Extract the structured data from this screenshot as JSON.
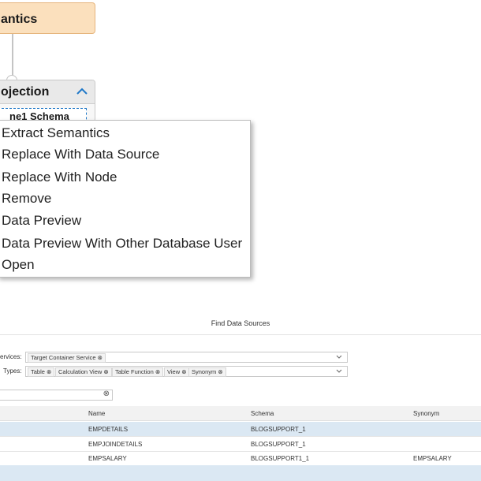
{
  "diagram": {
    "semantics_node_label": "antics",
    "projection_node_title": "ojection",
    "projection_item": "ne1 Schema"
  },
  "context_menu": {
    "items": [
      "Extract Semantics",
      "Replace With Data Source",
      "Replace With Node",
      "Remove",
      "Data Preview",
      "Data Preview With Other Database User",
      "Open"
    ]
  },
  "find_data_sources": {
    "title": "Find Data Sources",
    "services_label": "ervices:",
    "services_tokens": [
      "Target Container Service"
    ],
    "types_label": "Types:",
    "type_tokens": [
      "Table",
      "Calculation View",
      "Table Function",
      "View",
      "Synonym"
    ],
    "search_value": "",
    "columns": [
      "Name",
      "Schema",
      "Synonym"
    ],
    "rows": [
      {
        "name": "EMPDETAILS",
        "schema": "BLOGSUPPORT_1",
        "synonym": ""
      },
      {
        "name": "EMPJOINDETAILS",
        "schema": "BLOGSUPPORT_1",
        "synonym": ""
      },
      {
        "name": "EMPSALARY",
        "schema": "BLOGSUPPORT1_1",
        "synonym": "EMPSALARY"
      }
    ]
  },
  "colors": {
    "accent_blue": "#1f78c8",
    "selected_row": "#dbe8f3",
    "semantics_node": "#fbe0bd"
  }
}
